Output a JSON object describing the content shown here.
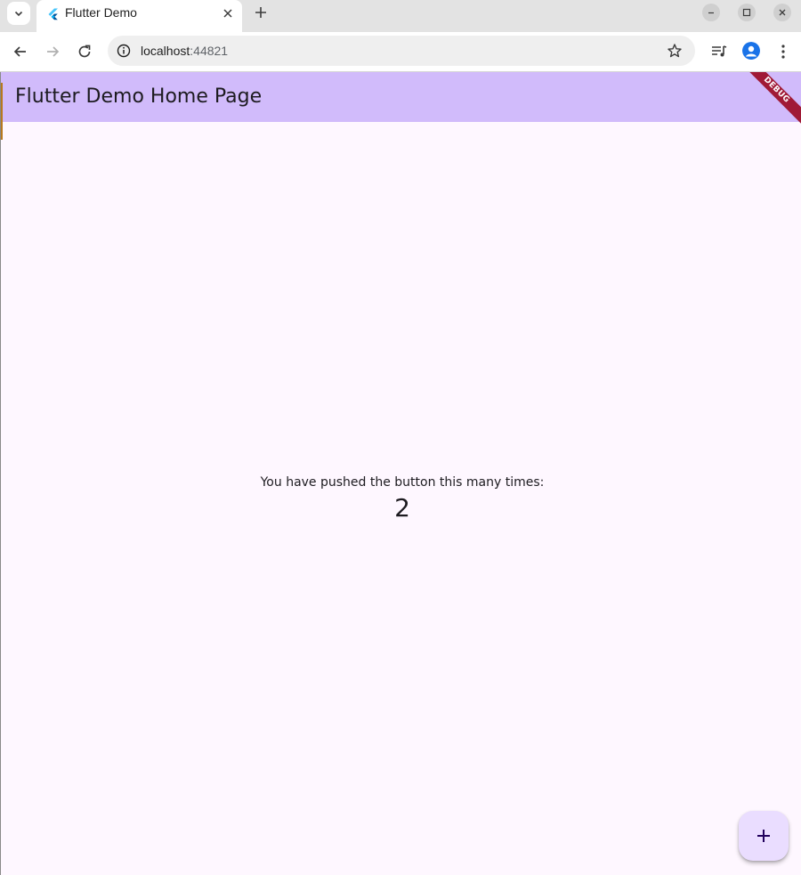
{
  "browser": {
    "tab": {
      "title": "Flutter Demo",
      "favicon": "flutter-logo-icon"
    },
    "address": {
      "host": "localhost",
      "port": ":44821"
    },
    "icons": {
      "tab_search": "chevron-down-icon",
      "tab_close": "close-icon",
      "new_tab": "plus-icon",
      "minimize": "minimize-icon",
      "maximize": "maximize-icon",
      "close_window": "close-icon",
      "back": "back-arrow-icon",
      "forward": "forward-arrow-icon",
      "reload": "reload-icon",
      "site_info": "info-icon",
      "bookmark": "star-icon",
      "media": "media-queue-icon",
      "profile": "profile-avatar-icon",
      "menu": "kebab-menu-icon"
    }
  },
  "app": {
    "appbar_title": "Flutter Demo Home Page",
    "debug_banner": "DEBUG",
    "counter_label": "You have pushed the button this many times:",
    "counter_value": "2",
    "fab_icon": "plus-icon",
    "colors": {
      "appbar": "#d1bbfb",
      "background": "#fef7ff",
      "fab": "#eaddff",
      "debug_banner": "#a01a36"
    }
  }
}
